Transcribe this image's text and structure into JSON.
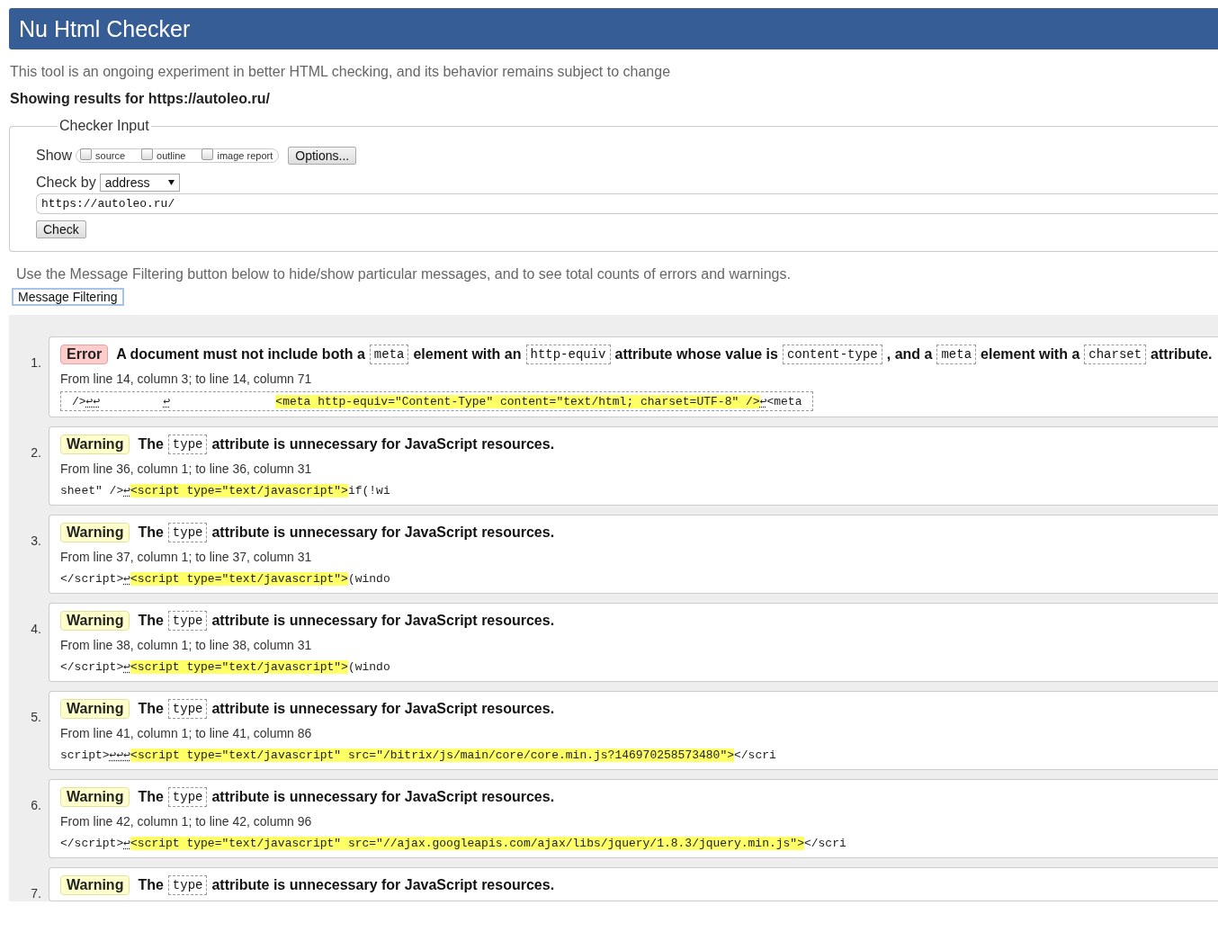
{
  "header": {
    "title": "Nu Html Checker"
  },
  "intro": "This tool is an ongoing experiment in better HTML checking, and its behavior remains subject to change",
  "results_for": "Showing results for https://autoleo.ru/",
  "checker_input": {
    "legend": "Checker Input",
    "show_label": "Show",
    "options": [
      {
        "label": "source",
        "checked": false
      },
      {
        "label": "outline",
        "checked": false
      },
      {
        "label": "image report",
        "checked": false
      }
    ],
    "options_button": "Options...",
    "check_by_label": "Check by",
    "check_by_value": "address",
    "url": "https://autoleo.ru/",
    "check_button": "Check"
  },
  "filter_note": "Use the Message Filtering button below to hide/show particular messages, and to see total counts of errors and warnings.",
  "filter_button": "Message Filtering",
  "messages": [
    {
      "number": "1.",
      "kind": "error",
      "label": "Error",
      "text": [
        {
          "kind": "text",
          "text": "A document must not include both a"
        },
        {
          "kind": "code",
          "text": "meta"
        },
        {
          "kind": "text",
          "text": "element with an"
        },
        {
          "kind": "code",
          "text": "http-equiv"
        },
        {
          "kind": "text",
          "text": "attribute whose value is"
        },
        {
          "kind": "code",
          "text": "content-type"
        },
        {
          "kind": "text",
          "text": ", and a"
        },
        {
          "kind": "code",
          "text": "meta"
        },
        {
          "kind": "text",
          "text": "element with a"
        },
        {
          "kind": "code",
          "text": "charset"
        },
        {
          "kind": "text",
          "text": "attribute."
        }
      ],
      "location": "From line 14, column 3; to line 14, column 71",
      "boxed": true,
      "extract": [
        {
          "kind": "text",
          "text": "/>"
        },
        {
          "kind": "lf",
          "text": "↩↩"
        },
        {
          "kind": "lf",
          "text": "         ↩"
        },
        {
          "kind": "mark",
          "text": "               <meta http-equiv=\"Content-Type\" content=\"text/html; charset=UTF-8\" />"
        },
        {
          "kind": "lf",
          "text": "↩"
        },
        {
          "kind": "text",
          "text": "<meta"
        }
      ]
    },
    {
      "number": "2.",
      "kind": "warning",
      "label": "Warning",
      "text": [
        {
          "kind": "text",
          "text": "The"
        },
        {
          "kind": "code",
          "text": "type"
        },
        {
          "kind": "text",
          "text": "attribute is unnecessary for JavaScript resources."
        }
      ],
      "location": "From line 36, column 1; to line 36, column 31",
      "boxed": false,
      "extract": [
        {
          "kind": "text",
          "text": "sheet\" />"
        },
        {
          "kind": "lf",
          "text": "↩"
        },
        {
          "kind": "mark",
          "text": "<script type=\"text/javascript\">"
        },
        {
          "kind": "text",
          "text": "if(!wi"
        }
      ]
    },
    {
      "number": "3.",
      "kind": "warning",
      "label": "Warning",
      "text": [
        {
          "kind": "text",
          "text": "The"
        },
        {
          "kind": "code",
          "text": "type"
        },
        {
          "kind": "text",
          "text": "attribute is unnecessary for JavaScript resources."
        }
      ],
      "location": "From line 37, column 1; to line 37, column 31",
      "boxed": false,
      "extract": [
        {
          "kind": "text",
          "text": "</script>"
        },
        {
          "kind": "lf",
          "text": "↩"
        },
        {
          "kind": "mark",
          "text": "<script type=\"text/javascript\">"
        },
        {
          "kind": "text",
          "text": "(windo"
        }
      ]
    },
    {
      "number": "4.",
      "kind": "warning",
      "label": "Warning",
      "text": [
        {
          "kind": "text",
          "text": "The"
        },
        {
          "kind": "code",
          "text": "type"
        },
        {
          "kind": "text",
          "text": "attribute is unnecessary for JavaScript resources."
        }
      ],
      "location": "From line 38, column 1; to line 38, column 31",
      "boxed": false,
      "extract": [
        {
          "kind": "text",
          "text": "</script>"
        },
        {
          "kind": "lf",
          "text": "↩"
        },
        {
          "kind": "mark",
          "text": "<script type=\"text/javascript\">"
        },
        {
          "kind": "text",
          "text": "(windo"
        }
      ]
    },
    {
      "number": "5.",
      "kind": "warning",
      "label": "Warning",
      "text": [
        {
          "kind": "text",
          "text": "The"
        },
        {
          "kind": "code",
          "text": "type"
        },
        {
          "kind": "text",
          "text": "attribute is unnecessary for JavaScript resources."
        }
      ],
      "location": "From line 41, column 1; to line 41, column 86",
      "boxed": false,
      "extract": [
        {
          "kind": "text",
          "text": "script>"
        },
        {
          "kind": "lf",
          "text": "↩↩↩"
        },
        {
          "kind": "mark",
          "text": "<script type=\"text/javascript\" src=\"/bitrix/js/main/core/core.min.js?146970258573480\">"
        },
        {
          "kind": "text",
          "text": "</scri"
        }
      ]
    },
    {
      "number": "6.",
      "kind": "warning",
      "label": "Warning",
      "text": [
        {
          "kind": "text",
          "text": "The"
        },
        {
          "kind": "code",
          "text": "type"
        },
        {
          "kind": "text",
          "text": "attribute is unnecessary for JavaScript resources."
        }
      ],
      "location": "From line 42, column 1; to line 42, column 96",
      "boxed": false,
      "extract": [
        {
          "kind": "text",
          "text": "</script>"
        },
        {
          "kind": "lf",
          "text": "↩"
        },
        {
          "kind": "mark",
          "text": "<script type=\"text/javascript\" src=\"//ajax.googleapis.com/ajax/libs/jquery/1.8.3/jquery.min.js\">"
        },
        {
          "kind": "text",
          "text": "</scri"
        }
      ]
    },
    {
      "number": "7.",
      "kind": "warning",
      "label": "Warning",
      "text": [
        {
          "kind": "text",
          "text": "The"
        },
        {
          "kind": "code",
          "text": "type"
        },
        {
          "kind": "text",
          "text": "attribute is unnecessary for JavaScript resources."
        }
      ]
    }
  ]
}
